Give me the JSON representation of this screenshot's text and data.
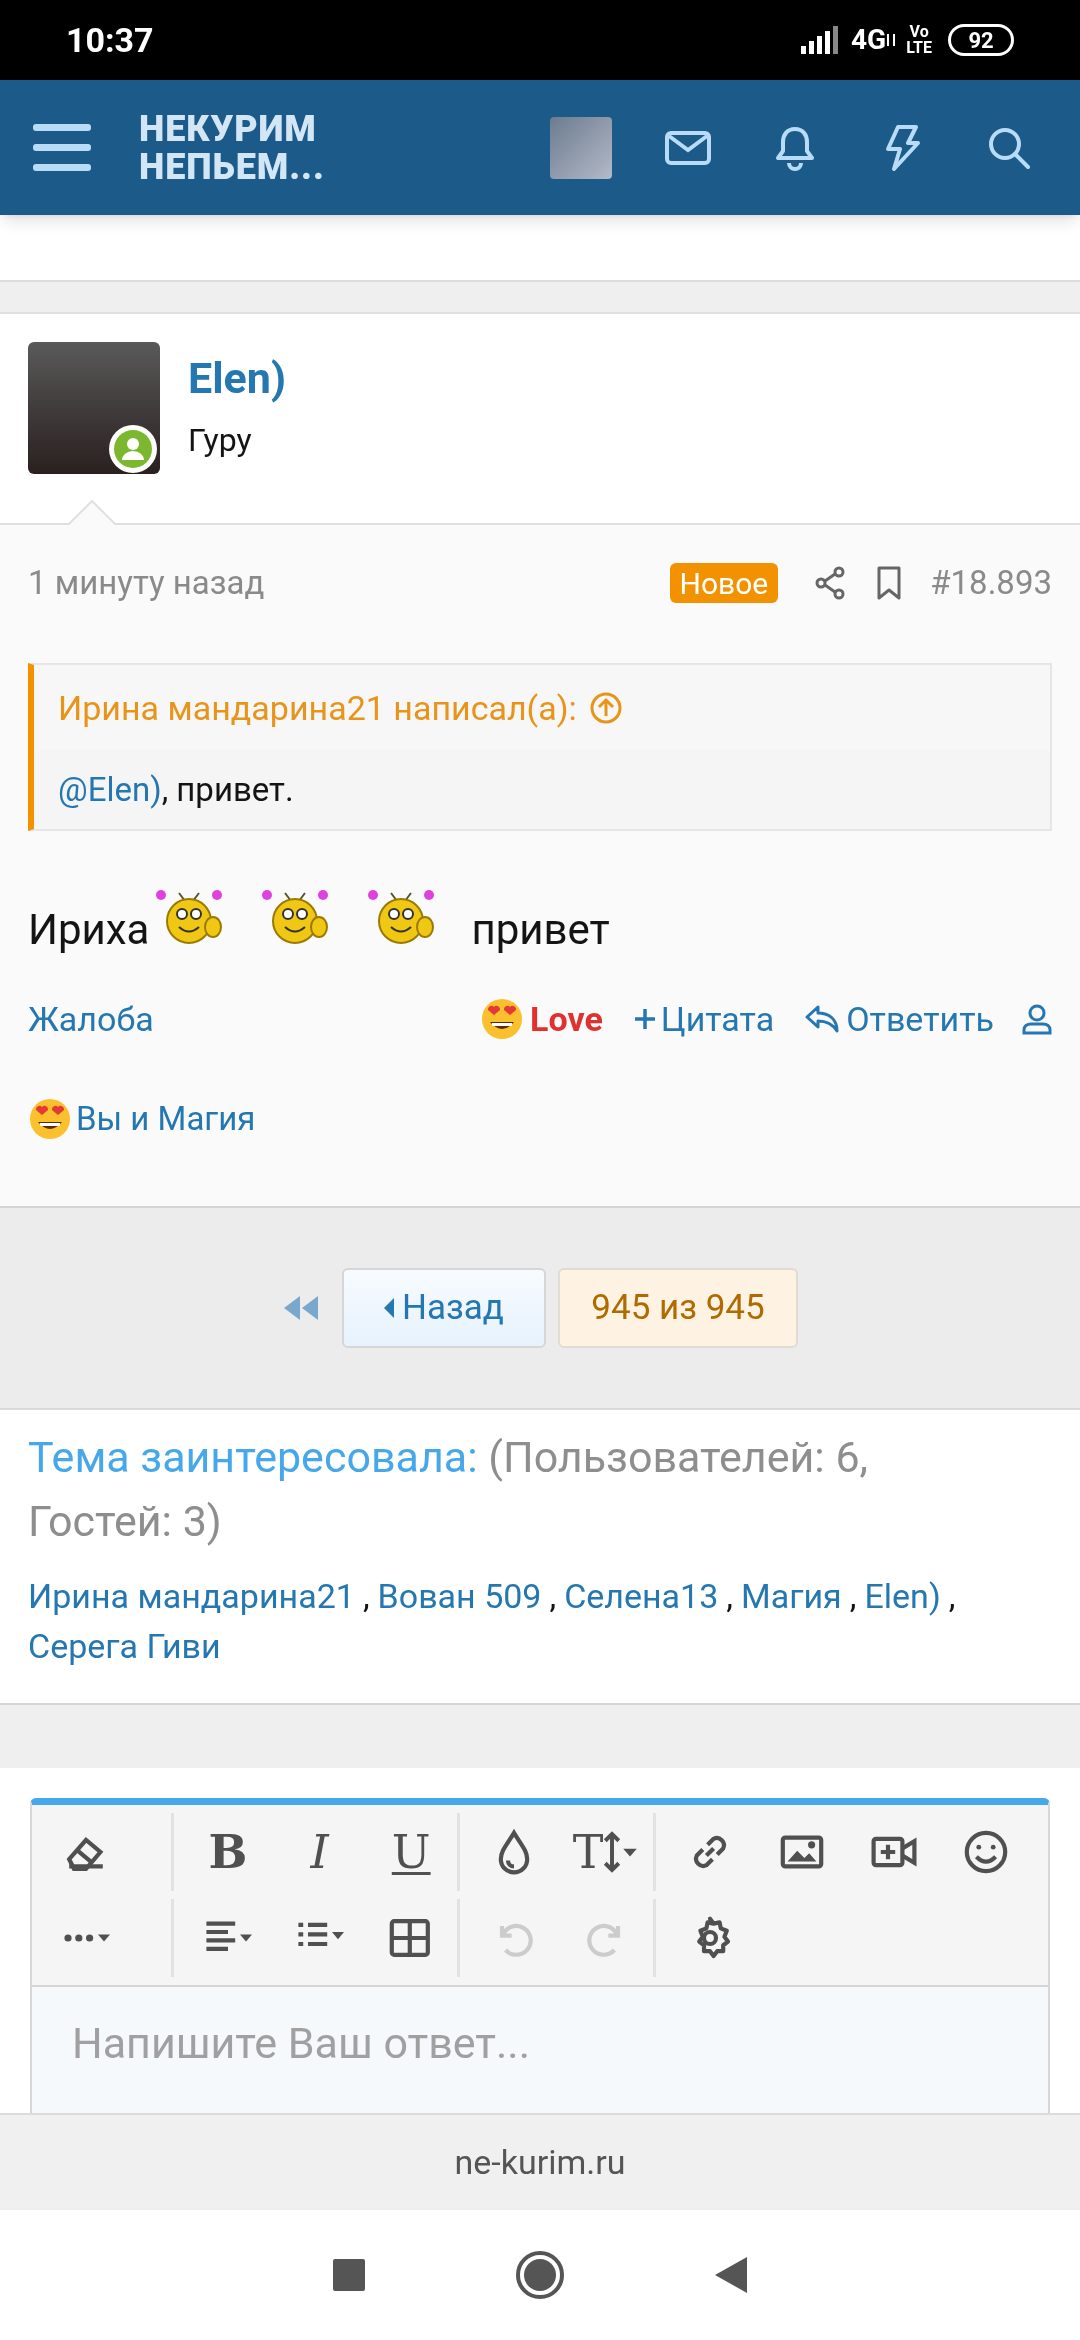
{
  "status_bar": {
    "time": "10:37",
    "network": "4G",
    "volte": [
      "Vo",
      "LTE"
    ],
    "battery": "92"
  },
  "header": {
    "logo_lines": [
      "НЕКУРИМ",
      "НЕПЬЕМ..."
    ]
  },
  "post": {
    "author": "Elen)",
    "user_title": "Гуру",
    "online": true,
    "time": "1 минуту назад",
    "badge": "Новое",
    "number": "#18.893",
    "quote": {
      "attribution": "Ирина мандарина21 написал(а):",
      "mention": "@Elen)",
      "text": ", привет."
    },
    "message": [
      {
        "kind": "text",
        "text": "Ириха"
      },
      {
        "kind": "smiley"
      },
      {
        "kind": "smiley"
      },
      {
        "kind": "smiley"
      },
      {
        "kind": "text",
        "text": "привет"
      }
    ],
    "actions": [
      {
        "kind": "report",
        "label": "Жалоба"
      },
      {
        "kind": "reaction",
        "label": "Love"
      },
      {
        "kind": "quote",
        "label": "Цитата"
      },
      {
        "kind": "reply",
        "label": "Ответить"
      },
      {
        "kind": "user"
      }
    ],
    "reactions": "Вы и Магия"
  },
  "pagination": {
    "back": "Назад",
    "page": "945 из 945"
  },
  "interested": {
    "title": "Тема заинтересовала:",
    "counts": "(Пользователей: 6, Гостей: 3)",
    "users": [
      {
        "name": "Ирина мандарина21",
        "separator": ","
      },
      {
        "name": "Вован 509",
        "separator": ","
      },
      {
        "name": "Селена13",
        "separator": ","
      },
      {
        "name": "Магия",
        "separator": ","
      },
      {
        "name": "Elen)",
        "separator": ","
      },
      {
        "name": "Серега Гиви"
      }
    ]
  },
  "editor": {
    "toolbar_rows": [
      [
        [
          {
            "kind": "eraser",
            "disabled": false
          }
        ],
        [
          {
            "kind": "bold",
            "label": "B",
            "disabled": false
          },
          {
            "kind": "italic",
            "label": "I",
            "disabled": false
          },
          {
            "kind": "underline",
            "label": "U",
            "disabled": false
          }
        ],
        [
          {
            "kind": "color",
            "disabled": false
          },
          {
            "kind": "font-size",
            "label": "T",
            "disabled": false
          }
        ],
        [
          {
            "kind": "link",
            "disabled": false
          },
          {
            "kind": "image",
            "disabled": false
          },
          {
            "kind": "video",
            "disabled": false
          },
          {
            "kind": "smilie",
            "disabled": false
          }
        ]
      ],
      [
        [
          {
            "kind": "more",
            "disabled": false
          }
        ],
        [
          {
            "kind": "align",
            "disabled": false
          },
          {
            "kind": "list",
            "disabled": false
          },
          {
            "kind": "table",
            "disabled": false
          }
        ],
        [
          {
            "kind": "undo",
            "disabled": true
          },
          {
            "kind": "redo",
            "disabled": true
          }
        ],
        [
          {
            "kind": "settings",
            "disabled": false
          }
        ]
      ]
    ],
    "placeholder": "Напишите Ваш ответ..."
  },
  "url_bar": "ne-kurim.ru"
}
